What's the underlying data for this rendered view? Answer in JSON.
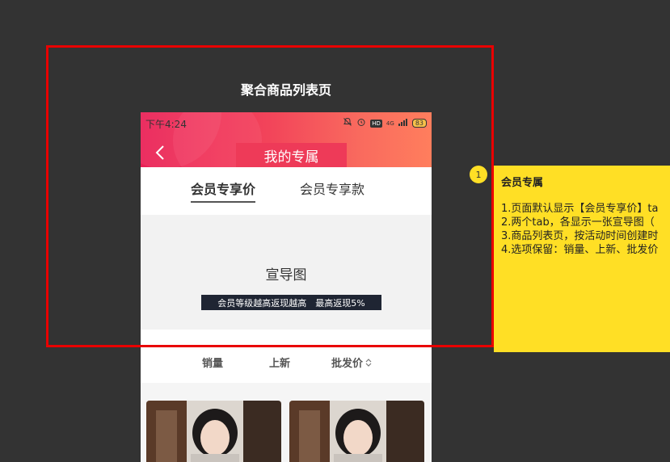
{
  "frame": {
    "title": "聚合商品列表页"
  },
  "status_bar": {
    "time": "下午4:24",
    "network": "4G",
    "hd": "HD",
    "battery": "83"
  },
  "nav": {
    "title": "我的专属"
  },
  "tabs": [
    {
      "label": "会员专享价",
      "active": true
    },
    {
      "label": "会员专享款",
      "active": false
    }
  ],
  "banner": {
    "title": "宣导图",
    "tag": "会员等级越高返现越高　最高返现5%"
  },
  "sort": [
    {
      "label": "销量"
    },
    {
      "label": "上新"
    },
    {
      "label": "批发价"
    }
  ],
  "note": {
    "index": "1",
    "title": "会员专属",
    "lines": [
      "1.页面默认显示【会员专享价】ta",
      "2.两个tab，各显示一张宣导图（",
      "3.商品列表页，按活动时间创建时",
      "4.选项保留：销量、上新、批发价"
    ]
  },
  "colors": {
    "header_start": "#ea1f55",
    "header_end": "#ff7e5d",
    "annotation_frame": "#e90000",
    "note_bg": "#ffdf25",
    "banner_tag_bg": "#1f2533"
  }
}
